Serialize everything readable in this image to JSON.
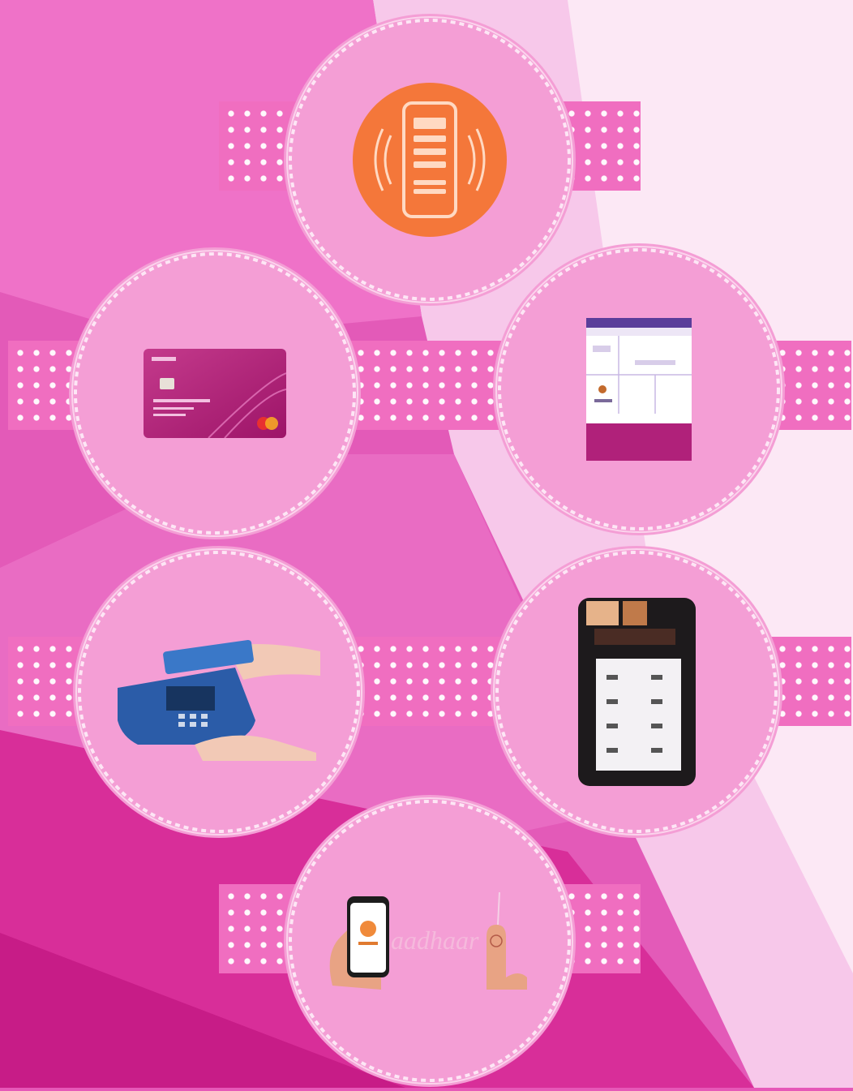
{
  "colors": {
    "background_dark": "#d92c98",
    "background_mid": "#ea5dbf",
    "background_light": "#fbe0f2",
    "medal_fill": "#f49ed5",
    "medal_edge": "#fde6f5",
    "tape_fill": "#f06ec0",
    "nfc_orange": "#f4773a",
    "card_magenta": "#b51f7b",
    "terminal_blue": "#2b5ca8"
  },
  "medals": [
    {
      "icon": "nfc-phone-icon"
    },
    {
      "icon": "debit-card-icon"
    },
    {
      "icon": "mobile-app-screen-icon"
    },
    {
      "icon": "card-terminal-icon"
    },
    {
      "icon": "pos-device-icon"
    },
    {
      "icon": "phone-fingerprint-icon"
    }
  ],
  "card": {
    "brand": "mastercard-logo-icon"
  },
  "aeps": {
    "text": "aadhaar"
  }
}
